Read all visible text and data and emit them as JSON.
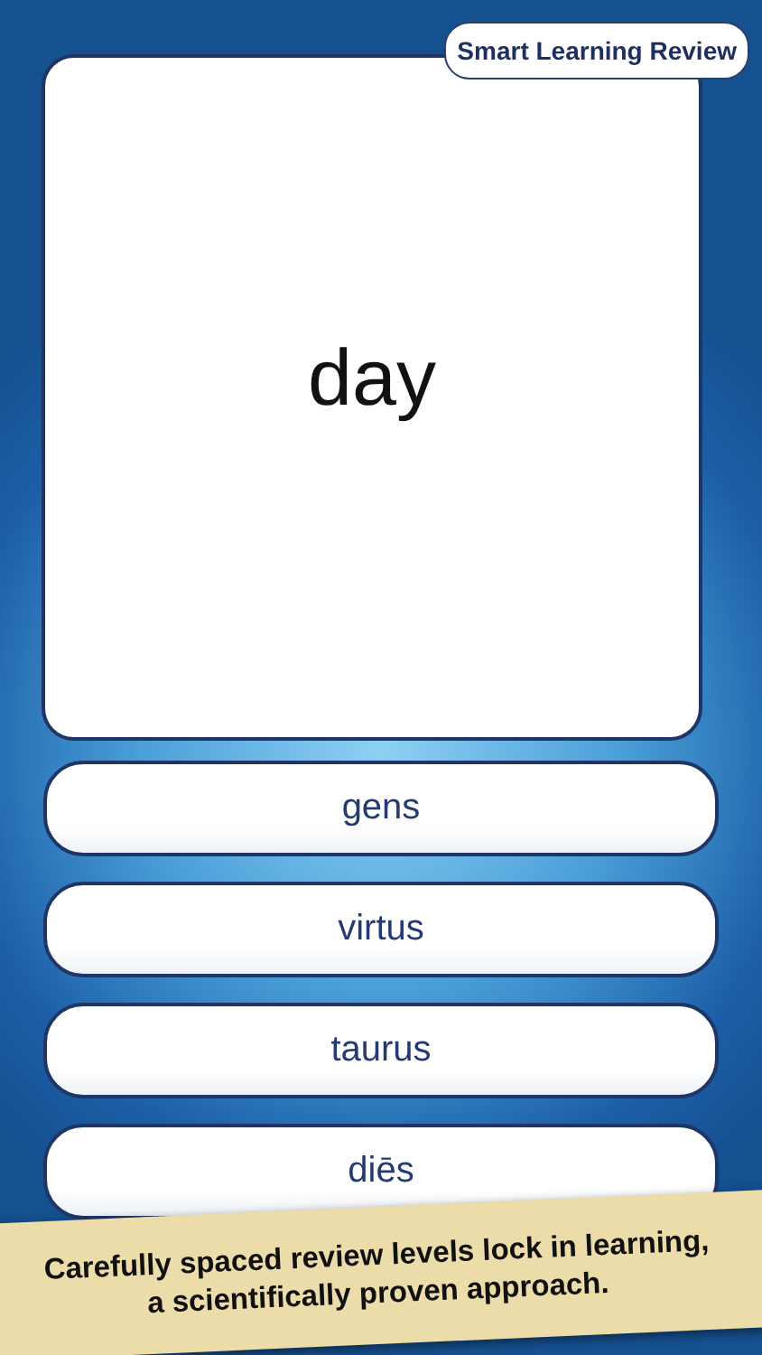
{
  "badge": "Smart Learning Review",
  "card": {
    "word": "day"
  },
  "answers": [
    {
      "label": "gens"
    },
    {
      "label": "virtus"
    },
    {
      "label": "taurus"
    },
    {
      "label": "diēs"
    }
  ],
  "banner": {
    "lines": [
      "Carefully spaced review levels lock in learning,",
      "a scientifically proven approach."
    ]
  }
}
